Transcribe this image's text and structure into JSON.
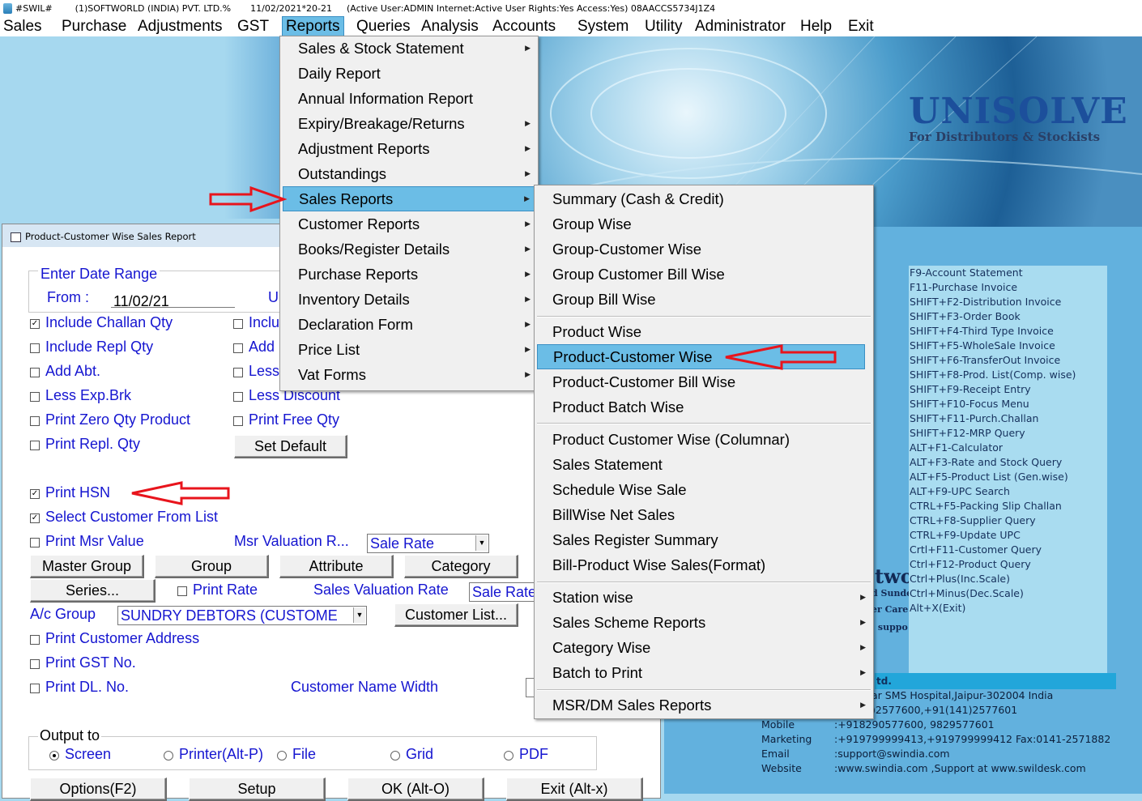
{
  "titlebar": {
    "app": "#SWIL#",
    "company": "(1)SOFTWORLD (INDIA) PVT. LTD.%",
    "date": "11/02/2021*20-21",
    "status": "(Active User:ADMIN Internet:Active  User Rights:Yes Access:Yes) 08AACCS5734J1Z4"
  },
  "menubar": [
    "Sales",
    "Purchase",
    "Adjustments",
    "GST",
    "Reports",
    "Queries",
    "Analysis",
    "Accounts",
    "System",
    "Utility",
    "Administrator",
    "Help",
    "Exit"
  ],
  "reports_menu": [
    "Sales & Stock Statement",
    "Daily Report",
    "Annual Information Report",
    "Expiry/Breakage/Returns",
    "Adjustment Reports",
    "Outstandings",
    "Sales Reports",
    "Customer Reports",
    "Books/Register Details",
    "Purchase Reports",
    "Inventory Details",
    "Declaration Form",
    "Price List",
    "Vat Forms"
  ],
  "sales_reports_menu": {
    "group1": [
      "Summary (Cash & Credit)",
      "Group Wise",
      "Group-Customer Wise",
      "Group Customer Bill Wise",
      "Group Bill Wise"
    ],
    "group2": [
      "Product Wise",
      "Product-Customer Wise",
      "Product-Customer Bill Wise",
      "Product Batch Wise"
    ],
    "group3": [
      "Product Customer Wise (Columnar)",
      "Sales Statement",
      "Schedule Wise Sale",
      "BillWise Net Sales",
      "Sales Register Summary",
      "Bill-Product Wise Sales(Format)"
    ],
    "group4": [
      "Station wise",
      "Sales Scheme Reports",
      "Category Wise",
      "Batch to Print"
    ],
    "group5": [
      "MSR/DM Sales Reports"
    ]
  },
  "brand": {
    "name": "UNISOLVE",
    "tagline": "For Distributors & Stockists",
    "accent": "#1c4f9b"
  },
  "hotkeys": [
    "F9-Account Statement",
    "F11-Purchase Invoice",
    "SHIFT+F2-Distribution Invoice",
    "SHIFT+F3-Order Book",
    "SHIFT+F4-Third Type Invoice",
    "SHIFT+F5-WholeSale Invoice",
    "SHIFT+F6-TransferOut Invoice",
    "SHIFT+F8-Prod. List(Comp. wise)",
    "SHIFT+F9-Receipt Entry",
    "SHIFT+F10-Focus Menu",
    "SHIFT+F11-Purch.Challan",
    "SHIFT+F12-MRP Query",
    "ALT+F1-Calculator",
    "ALT+F3-Rate and Stock Query",
    "ALT+F5-Product List (Gen.wise)",
    "ALT+F9-UPC Search",
    "CTRL+F5-Packing Slip Challan",
    "CTRL+F8-Supplier Query",
    "CTRL+F9-Update UPC",
    "Crtl+F11-Customer Query",
    "Ctrl+F12-Product Query",
    "Ctrl+Plus(Inc.Scale)",
    "Ctrl+Minus(Dec.Scale)",
    "Alt+X(Exit)"
  ],
  "contact": {
    "strip": "td.",
    "address": "ar SMS Hospital,Jaipur-302004 India",
    "phone": ")2577600,+91(141)2577601",
    "mobile_label": "Mobile",
    "mobile": ":+918290577600, 9829577601",
    "marketing_label": "Marketing",
    "marketing": ":+919799999413,+919799999412 Fax:0141-2571882",
    "email_label": "Email",
    "email": ":support@swindia.com",
    "website_label": "Website",
    "website": ":www.swindia.com ,Support at www.swildesk.com",
    "partial1": "two",
    "partial2": "d Sunde",
    "partial3": "er Care",
    "partial4": ": suppo"
  },
  "dialog": {
    "title": "Product-Customer Wise Sales Report",
    "date_range_label": "Enter Date Range",
    "from_label": "From :",
    "from_value": "11/02/21",
    "upto_partial": "U",
    "checks": {
      "include_challan": "Include Challan Qty",
      "inclu_partial": "Inclu",
      "include_repl": "Include Repl Qty",
      "add_partial": "Add",
      "add_abt": "Add Abt.",
      "less_partial": "Less",
      "less_exp": "Less Exp.Brk",
      "less_discount": "Less Discount",
      "print_zero": "Print Zero Qty Product",
      "print_free": "Print Free Qty",
      "print_repl": "Print Repl. Qty",
      "print_hsn": "Print HSN",
      "select_customer": "Select Customer From List",
      "print_msr": "Print Msr Value",
      "print_rate": "Print Rate",
      "print_address": "Print Customer Address",
      "print_gst": "Print GST No.",
      "print_dl": "Print DL. No."
    },
    "set_default": "Set Default",
    "msr_valuation_label": "Msr Valuation R...",
    "msr_valuation_value": "Sale Rate",
    "buttons_row1": [
      "Master Group",
      "Group",
      "Attribute",
      "Category"
    ],
    "series_button": "Series...",
    "sales_valuation_label": "Sales Valuation Rate",
    "sales_valuation_value": "Sale Rate",
    "ac_group_label": "A/c Group",
    "ac_group_value": "SUNDRY DEBTORS (CUSTOME",
    "customer_list_button": "Customer List...",
    "customer_name_width_label": "Customer Name Width",
    "output_label": "Output to",
    "outputs": [
      "Screen",
      "Printer(Alt-P)",
      "File",
      "Grid",
      "PDF"
    ],
    "bottom_buttons": [
      "Options(F2)",
      "Setup",
      "OK (Alt-O)",
      "Exit (Alt-x)"
    ]
  },
  "colors": {
    "label_blue": "#1515d0",
    "highlight": "#6bbde6",
    "annotation_red": "#e8141c"
  }
}
